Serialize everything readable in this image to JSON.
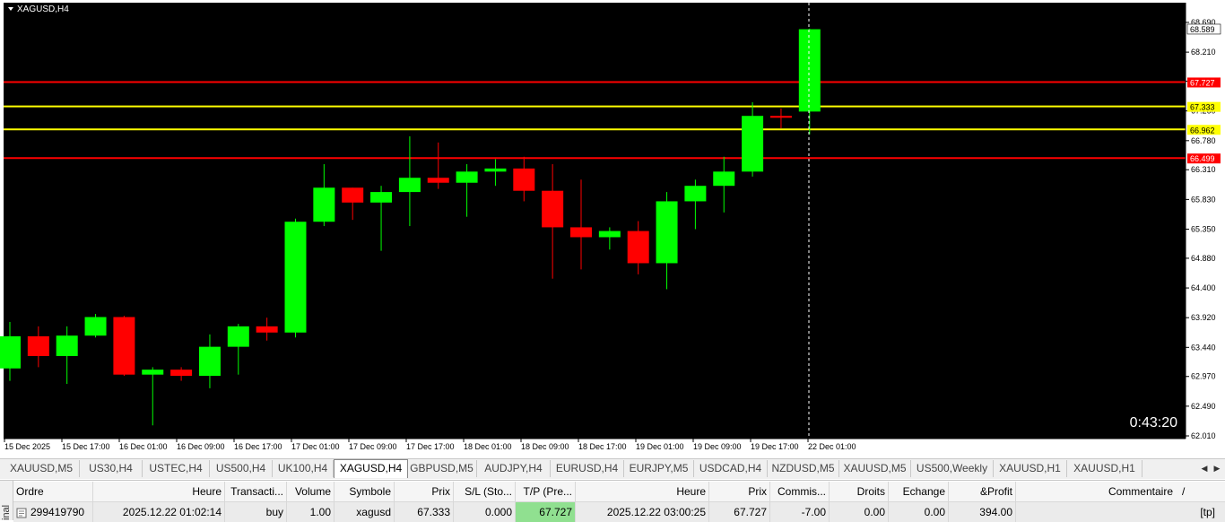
{
  "chart": {
    "title": "XAGUSD,H4",
    "timer": "0:43:20",
    "price_labels": [
      "68.690",
      "68.210",
      "67.740",
      "67.260",
      "66.780",
      "66.310",
      "65.830",
      "65.350",
      "64.880",
      "64.400",
      "63.920",
      "63.440",
      "62.970",
      "62.490",
      "62.010"
    ],
    "time_labels": [
      "15 Dec 2025",
      "15 Dec 17:00",
      "16 Dec 01:00",
      "16 Dec 09:00",
      "16 Dec 17:00",
      "17 Dec 01:00",
      "17 Dec 09:00",
      "17 Dec 17:00",
      "18 Dec 01:00",
      "18 Dec 09:00",
      "18 Dec 17:00",
      "19 Dec 01:00",
      "19 Dec 09:00",
      "19 Dec 17:00",
      "22 Dec 01:00"
    ],
    "current_price": "68.589",
    "levels": [
      {
        "label": "67.727",
        "price": 67.727,
        "color": "#ff0000"
      },
      {
        "label": "67.333",
        "price": 67.333,
        "color": "#ffff00"
      },
      {
        "label": "66.962",
        "price": 66.962,
        "color": "#ffff00"
      },
      {
        "label": "66.499",
        "price": 66.499,
        "color": "#ff0000"
      }
    ],
    "colors": {
      "bg": "#000000",
      "bull": "#00ff00",
      "bear": "#ff0000",
      "axis": "#000000",
      "dashed": "#ffffff"
    }
  },
  "chart_data": {
    "type": "candlestick",
    "ylim": [
      62.01,
      68.69
    ],
    "x": [
      "15 Dec 2025",
      "",
      "",
      "",
      "15 Dec 17:00",
      "",
      "16 Dec 01:00",
      "",
      "16 Dec 09:00",
      "",
      "16 Dec 17:00",
      "",
      "17 Dec 01:00",
      "",
      "17 Dec 09:00",
      "",
      "17 Dec 17:00",
      "",
      "18 Dec 01:00",
      "",
      "18 Dec 09:00",
      "",
      "18 Dec 17:00",
      "",
      "19 Dec 01:00",
      "",
      "19 Dec 09:00",
      "",
      "19 Dec 17:00",
      "22 Dec 01:00"
    ],
    "ohlc": [
      [
        63.1,
        63.85,
        62.9,
        63.62
      ],
      [
        63.62,
        63.78,
        63.12,
        63.3
      ],
      [
        63.3,
        63.78,
        62.85,
        63.63
      ],
      [
        63.63,
        63.98,
        63.6,
        63.93
      ],
      [
        63.93,
        63.95,
        62.98,
        63.0
      ],
      [
        63.0,
        63.12,
        62.18,
        63.08
      ],
      [
        63.08,
        63.12,
        62.9,
        62.98
      ],
      [
        62.98,
        63.65,
        62.78,
        63.45
      ],
      [
        63.45,
        63.82,
        63.0,
        63.78
      ],
      [
        63.78,
        63.92,
        63.55,
        63.68
      ],
      [
        63.68,
        65.52,
        63.6,
        65.47
      ],
      [
        65.47,
        66.4,
        65.4,
        66.02
      ],
      [
        66.02,
        66.02,
        65.5,
        65.78
      ],
      [
        65.78,
        66.05,
        65.0,
        65.95
      ],
      [
        65.95,
        66.85,
        65.4,
        66.18
      ],
      [
        66.18,
        66.75,
        66.0,
        66.1
      ],
      [
        66.1,
        66.4,
        65.55,
        66.28
      ],
      [
        66.28,
        66.48,
        66.05,
        66.33
      ],
      [
        66.33,
        66.52,
        65.8,
        65.97
      ],
      [
        65.97,
        66.4,
        64.55,
        65.38
      ],
      [
        65.38,
        66.15,
        64.7,
        65.22
      ],
      [
        65.22,
        65.38,
        65.02,
        65.32
      ],
      [
        65.32,
        65.48,
        64.62,
        64.8
      ],
      [
        64.8,
        65.95,
        64.38,
        65.8
      ],
      [
        65.8,
        66.15,
        65.35,
        66.05
      ],
      [
        66.05,
        66.52,
        65.62,
        66.28
      ],
      [
        66.28,
        67.4,
        66.2,
        67.18
      ],
      [
        67.18,
        67.3,
        66.98,
        67.15
      ],
      [
        67.25,
        68.59,
        66.88,
        68.58
      ]
    ]
  },
  "tabs": {
    "items": [
      "XAUUSD,M5",
      "US30,H4",
      "USTEC,H4",
      "US500,H4",
      "UK100,H4",
      "XAGUSD,H4",
      "GBPUSD,M5",
      "AUDJPY,H4",
      "EURUSD,H4",
      "EURJPY,M5",
      "USDCAD,H4",
      "NZDUSD,M5",
      "XAUUSD,M5",
      "US500,Weekly",
      "XAUUSD,H1",
      "XAUUSD,H1"
    ],
    "active": 5,
    "scroll_left": "◀",
    "scroll_right": "▶"
  },
  "terminal": {
    "side_label": "inal",
    "headers": [
      "Ordre",
      "Heure",
      "Transacti...",
      "Volume",
      "Symbole",
      "Prix",
      "S/L (Sto...",
      "T/P (Pre...",
      "Heure",
      "Prix",
      "Commis...",
      "Droits",
      "Echange",
      "&Profit",
      "Commentaire"
    ],
    "sort_indicator": "/",
    "row": [
      "299419790",
      "2025.12.22 01:02:14",
      "buy",
      "1.00",
      "xagusd",
      "67.333",
      "0.000",
      "67.727",
      "2025.12.22 03:00:25",
      "67.727",
      "-7.00",
      "0.00",
      "0.00",
      "394.00",
      "[tp]"
    ]
  }
}
